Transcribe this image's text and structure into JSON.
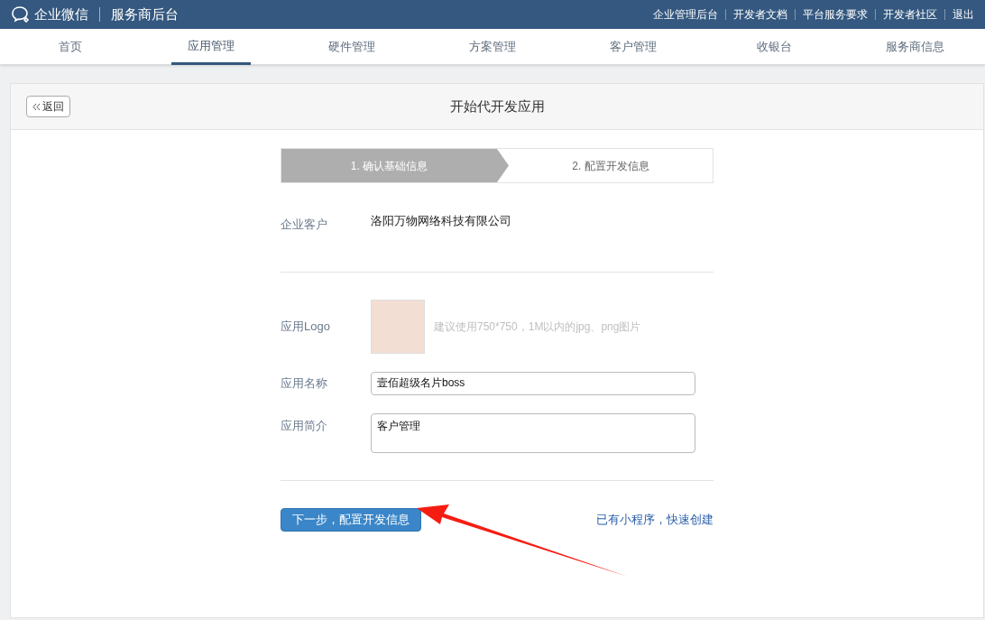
{
  "header": {
    "brand": "企业微信",
    "subtitle": "服务商后台",
    "links": [
      "企业管理后台",
      "开发者文档",
      "平台服务要求",
      "开发者社区",
      "退出"
    ]
  },
  "nav": [
    {
      "label": "首页",
      "selected": false
    },
    {
      "label": "应用管理",
      "selected": true
    },
    {
      "label": "硬件管理",
      "selected": false
    },
    {
      "label": "方案管理",
      "selected": false
    },
    {
      "label": "客户管理",
      "selected": false
    },
    {
      "label": "收银台",
      "selected": false
    },
    {
      "label": "服务商信息",
      "selected": false
    }
  ],
  "page": {
    "back": "返回",
    "title": "开始代开发应用"
  },
  "steps": [
    {
      "label": "1. 确认基础信息",
      "selected": true
    },
    {
      "label": "2. 配置开发信息",
      "selected": false
    }
  ],
  "customer": {
    "label": "企业客户",
    "value": "洛阳万物网络科技有限公司"
  },
  "logo": {
    "label": "应用Logo",
    "hint": "建议使用750*750，1M以内的jpg、png图片"
  },
  "name": {
    "label": "应用名称",
    "value": "壹佰超级名片boss"
  },
  "intro": {
    "label": "应用简介",
    "value": "客户管理"
  },
  "next_button": "下一步，配置开发信息",
  "quick_link": "已有小程序，快速创建"
}
